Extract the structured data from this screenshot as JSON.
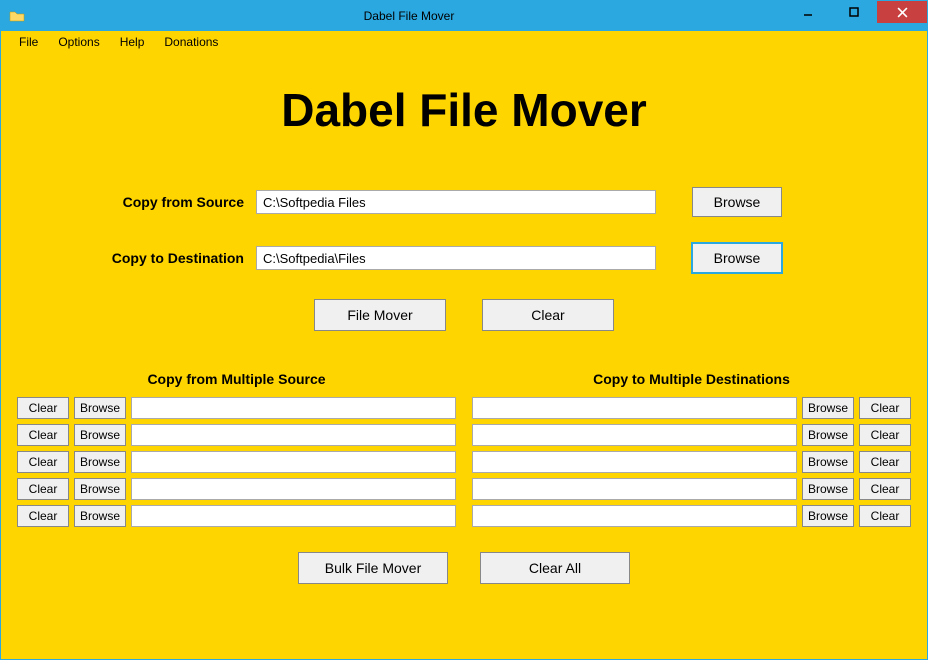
{
  "window": {
    "title": "Dabel File Mover"
  },
  "menubar": {
    "items": [
      "File",
      "Options",
      "Help",
      "Donations"
    ]
  },
  "heading": "Dabel File Mover",
  "source": {
    "label": "Copy from Source",
    "value": "C:\\Softpedia Files",
    "browse": "Browse"
  },
  "destination": {
    "label": "Copy to Destination",
    "value": "C:\\Softpedia\\Files",
    "browse": "Browse"
  },
  "actions": {
    "move": "File Mover",
    "clear": "Clear"
  },
  "multi": {
    "source_header": "Copy from Multiple Source",
    "dest_header": "Copy to Multiple Destinations",
    "clear_label": "Clear",
    "browse_label": "Browse",
    "source_rows": [
      {
        "value": ""
      },
      {
        "value": ""
      },
      {
        "value": ""
      },
      {
        "value": ""
      },
      {
        "value": ""
      }
    ],
    "dest_rows": [
      {
        "value": ""
      },
      {
        "value": ""
      },
      {
        "value": ""
      },
      {
        "value": ""
      },
      {
        "value": ""
      }
    ]
  },
  "bottom": {
    "bulk": "Bulk File Mover",
    "clear_all": "Clear All"
  }
}
